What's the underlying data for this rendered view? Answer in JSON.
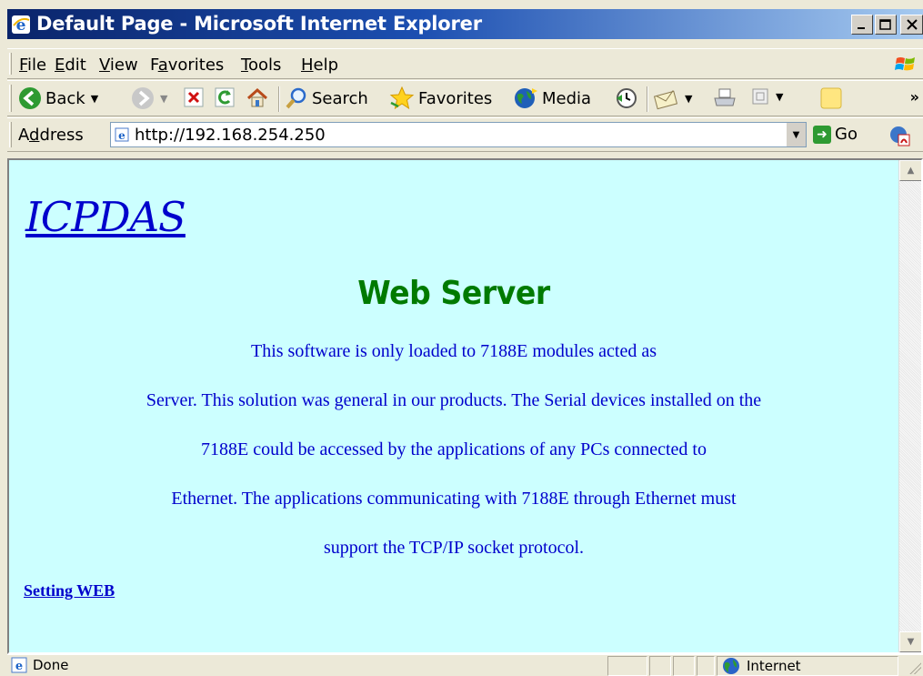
{
  "window": {
    "title": "Default Page - Microsoft Internet Explorer",
    "minimize_label": "_",
    "maximize_label": "□",
    "close_label": "×"
  },
  "menubar": {
    "items": [
      {
        "key": "F",
        "rest": "ile"
      },
      {
        "key": "E",
        "rest": "dit"
      },
      {
        "key": "V",
        "rest": "iew"
      },
      {
        "pre": "F",
        "key": "a",
        "rest": "vorites"
      },
      {
        "key": "T",
        "rest": "ools"
      },
      {
        "key": "H",
        "rest": "elp"
      }
    ]
  },
  "toolbar": {
    "back_label": "Back",
    "search_label": "Search",
    "favorites_label": "Favorites",
    "media_label": "Media",
    "chevron_label": "»"
  },
  "addressbar": {
    "label_pre": "A",
    "label_key": "d",
    "label_rest": "dress",
    "url": "http://192.168.254.250",
    "go_label": "Go"
  },
  "page": {
    "logo": "ICPDAS",
    "heading": "Web Server",
    "lines": [
      "This software is only loaded to 7188E modules acted as",
      "Server. This solution was general in our products. The Serial devices installed on the",
      "7188E could be accessed by the applications of any PCs connected to",
      "Ethernet. The applications communicating with 7188E through Ethernet must",
      "support the TCP/IP socket protocol."
    ],
    "setting_link": "Setting WEB"
  },
  "statusbar": {
    "status": "Done",
    "zone": "Internet"
  },
  "colors": {
    "page_background": "#ccffff",
    "heading": "#007a00",
    "text": "#0000cc"
  }
}
